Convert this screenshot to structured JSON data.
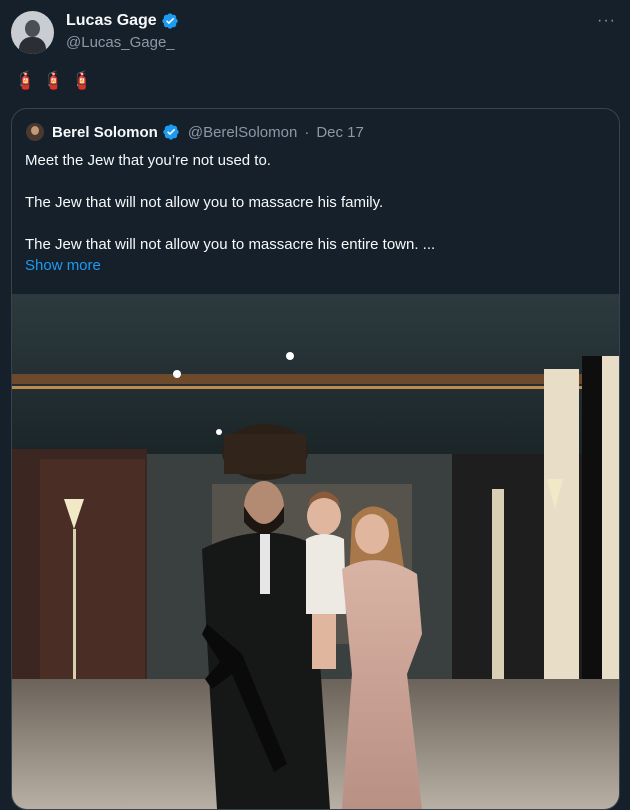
{
  "tweet": {
    "author_name": "Lucas Gage",
    "author_handle": "@Lucas_Gage_",
    "more_label": "···",
    "text": "🧯🧯🧯"
  },
  "quote": {
    "author_name": "Berel Solomon",
    "author_handle": "@BerelSolomon",
    "separator": "·",
    "date": "Dec 17",
    "lines": [
      "Meet the Jew that you’re not used to.",
      "The Jew that will not allow you to massacre his family.",
      "The Jew that will not allow you to massacre his entire town. ..."
    ],
    "show_more": "Show more"
  },
  "colors": {
    "background": "#15202b",
    "text": "#f7f9f9",
    "secondary": "#8b98a5",
    "link": "#1d9bf0",
    "verified": "#1d9bf0",
    "border": "#38444d"
  }
}
